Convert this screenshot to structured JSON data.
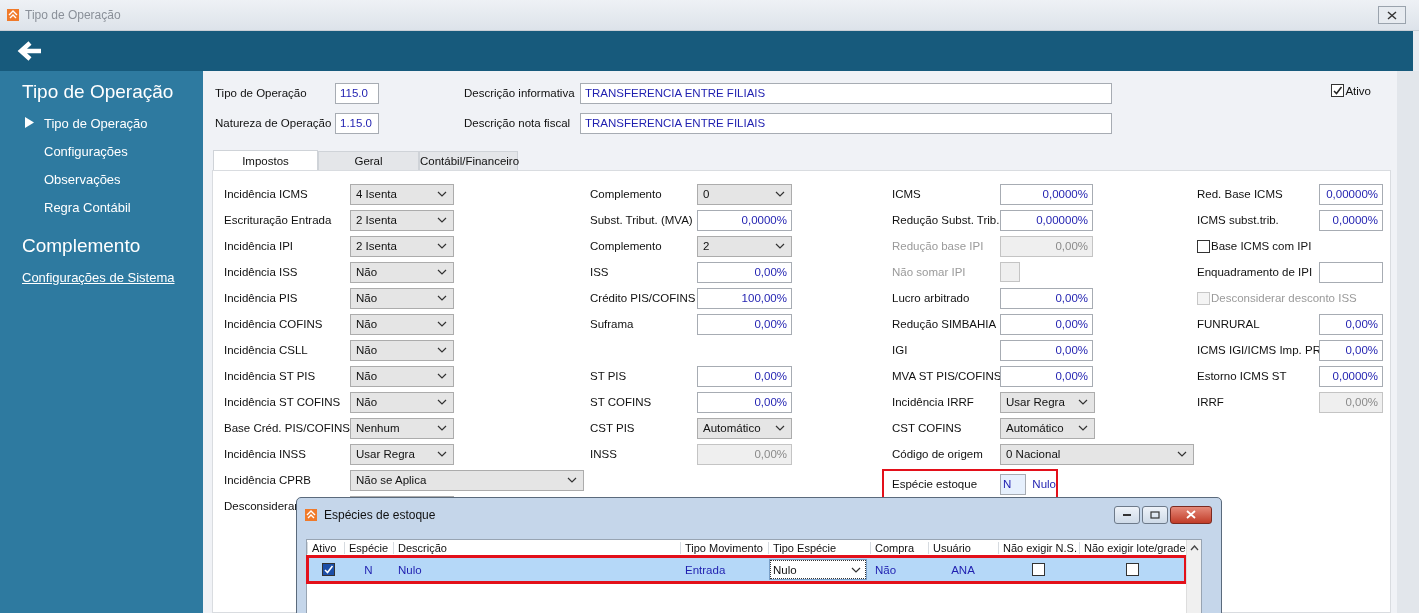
{
  "window": {
    "title": "Tipo de Operação"
  },
  "sidebar": {
    "sections": [
      {
        "title": "Tipo de Operação",
        "items": [
          {
            "label": "Tipo de Operação",
            "kind": "nav",
            "selected": true
          },
          {
            "label": "Configurações",
            "kind": "nav",
            "selected": false
          },
          {
            "label": "Observações",
            "kind": "nav",
            "selected": false
          },
          {
            "label": "Regra Contábil",
            "kind": "nav",
            "selected": false
          }
        ]
      },
      {
        "title": "Complemento",
        "items": [
          {
            "label": "Configurações de Sistema",
            "kind": "link",
            "selected": false
          }
        ]
      }
    ]
  },
  "header_fields": [
    {
      "label": "Tipo de Operação",
      "value": "115.0",
      "label2": "Descrição informativa",
      "value2": "TRANSFERENCIA ENTRE FILIAIS"
    },
    {
      "label": "Natureza de Operação",
      "value": "1.15.0",
      "label2": "Descrição nota fiscal",
      "value2": "TRANSFERENCIA ENTRE FILIAIS"
    }
  ],
  "ativo": {
    "label": "Ativo",
    "checked": true
  },
  "tabs": [
    {
      "label": "Impostos",
      "selected": true
    },
    {
      "label": "Geral",
      "selected": false
    },
    {
      "label": "Contábil/Financeiro",
      "selected": false
    }
  ],
  "columns": [
    {
      "rows": [
        {
          "label": "Incidência ICMS",
          "kind": "select",
          "value": "4 Isenta",
          "disabled": false
        },
        {
          "label": "Escrituração Entrada",
          "kind": "select",
          "value": "2 Isenta",
          "disabled": false
        },
        {
          "label": "Incidência IPI",
          "kind": "select",
          "value": "2 Isenta",
          "disabled": false
        },
        {
          "label": "Incidência ISS",
          "kind": "select",
          "value": "Não",
          "disabled": false
        },
        {
          "label": "Incidência PIS",
          "kind": "select",
          "value": "Não",
          "disabled": false
        },
        {
          "label": "Incidência COFINS",
          "kind": "select",
          "value": "Não",
          "disabled": false
        },
        {
          "label": "Incidência CSLL",
          "kind": "select",
          "value": "Não",
          "disabled": false
        },
        {
          "label": "Incidência ST PIS",
          "kind": "select",
          "value": "Não",
          "disabled": false
        },
        {
          "label": "Incidência ST COFINS",
          "kind": "select",
          "value": "Não",
          "disabled": false
        },
        {
          "label": "Base Créd. PIS/COFINS",
          "kind": "select",
          "value": "Nenhum",
          "disabled": false
        },
        {
          "label": "Incidência INSS",
          "kind": "select",
          "value": "Usar Regra",
          "disabled": false
        },
        {
          "label": "Incidência CPRB",
          "kind": "select-wide",
          "value": "Não se Aplica",
          "disabled": false
        },
        {
          "label": "Desconsiderar",
          "kind": "select",
          "disabled": false
        }
      ]
    },
    {
      "rows": [
        {
          "label": "Complemento",
          "kind": "select",
          "value": "0",
          "disabled": false
        },
        {
          "label": "Subst. Tribut. (MVA)",
          "kind": "input",
          "value": "0,0000%",
          "disabled": false
        },
        {
          "label": "Complemento",
          "kind": "select",
          "value": "2",
          "disabled": false
        },
        {
          "label": "ISS",
          "kind": "input",
          "value": "0,00%",
          "disabled": false
        },
        {
          "label": "Crédito PIS/COFINS",
          "kind": "input",
          "value": "100,00%",
          "disabled": false
        },
        {
          "label": "Suframa",
          "kind": "input",
          "value": "0,00%",
          "disabled": false
        },
        {
          "kind": "blank"
        },
        {
          "label": "ST PIS",
          "kind": "input",
          "value": "0,00%",
          "disabled": false
        },
        {
          "label": "ST COFINS",
          "kind": "input",
          "value": "0,00%",
          "disabled": false
        },
        {
          "label": "CST PIS",
          "kind": "select",
          "value": "Automático",
          "disabled": false
        },
        {
          "label": "INSS",
          "kind": "readonly",
          "value": "0,00%",
          "disabled": false
        }
      ]
    },
    {
      "rows": [
        {
          "label": "ICMS",
          "kind": "input",
          "value": "0,0000%",
          "disabled": false
        },
        {
          "label": "Redução Subst. Trib.",
          "kind": "input",
          "value": "0,00000%",
          "disabled": false
        },
        {
          "label": "Redução base IPI",
          "kind": "readonly",
          "value": "0,00%",
          "disabled": true
        },
        {
          "label": "Não somar IPI",
          "kind": "flag",
          "checked": false,
          "disabled": true
        },
        {
          "label": "Lucro arbitrado",
          "kind": "input",
          "value": "0,00%",
          "disabled": false
        },
        {
          "label": "Redução SIMBAHIA",
          "kind": "input",
          "value": "0,00%",
          "disabled": false
        },
        {
          "label": "IGI",
          "kind": "input",
          "value": "0,00%",
          "disabled": false
        },
        {
          "label": "MVA ST PIS/COFINS",
          "kind": "input",
          "value": "0,00%",
          "disabled": false
        },
        {
          "label": "Incidência IRRF",
          "kind": "select",
          "value": "Usar Regra",
          "disabled": false
        },
        {
          "label": "CST COFINS",
          "kind": "select",
          "value": "Automático",
          "disabled": false
        },
        {
          "label": "Código de origem",
          "kind": "select-wide",
          "value": "0 Nacional",
          "disabled": false
        },
        {
          "label": "Espécie estoque",
          "kind": "especie",
          "value": "N",
          "suffix": "Nulo",
          "disabled": false,
          "highlight": true
        }
      ]
    },
    {
      "rows": [
        {
          "label": "Red. Base ICMS",
          "kind": "input",
          "value": "0,00000%",
          "disabled": false
        },
        {
          "label": "ICMS subst.trib.",
          "kind": "input",
          "value": "0,0000%",
          "disabled": false
        },
        {
          "label": "Base ICMS com IPI",
          "kind": "checkbox",
          "checked": false,
          "disabled": false
        },
        {
          "label": "Enquadramento de IPI",
          "kind": "input",
          "disabled": false
        },
        {
          "label": "Desconsiderar desconto ISS",
          "kind": "checkbox",
          "checked": false,
          "disabled": true
        },
        {
          "label": "FUNRURAL",
          "kind": "input",
          "value": "0,00%",
          "disabled": false
        },
        {
          "label": "ICMS IGI/ICMS Imp. PR",
          "kind": "input",
          "value": "0,00%",
          "disabled": false
        },
        {
          "label": "Estorno ICMS ST",
          "kind": "input",
          "value": "0,0000%",
          "disabled": false
        },
        {
          "label": "IRRF",
          "kind": "readonly",
          "value": "0,00%",
          "disabled": false
        }
      ]
    }
  ],
  "dialog": {
    "title": "Espécies de estoque",
    "columns": [
      "Ativo",
      "Espécie",
      "Descrição",
      "Tipo Movimento",
      "Tipo Espécie",
      "Compra",
      "Usuário",
      "Não exigir N.S.",
      "Não exigir lote/grade"
    ],
    "rows": [
      {
        "ativo": true,
        "especie": "N",
        "descricao": "Nulo",
        "tipo_movimento": "Entrada",
        "tipo_especie": "Nulo",
        "compra": "Não",
        "usuario": "ANA",
        "nao_exigir_ns": false,
        "nao_exigir_lote": false,
        "selected": true,
        "highlight": true
      }
    ]
  }
}
